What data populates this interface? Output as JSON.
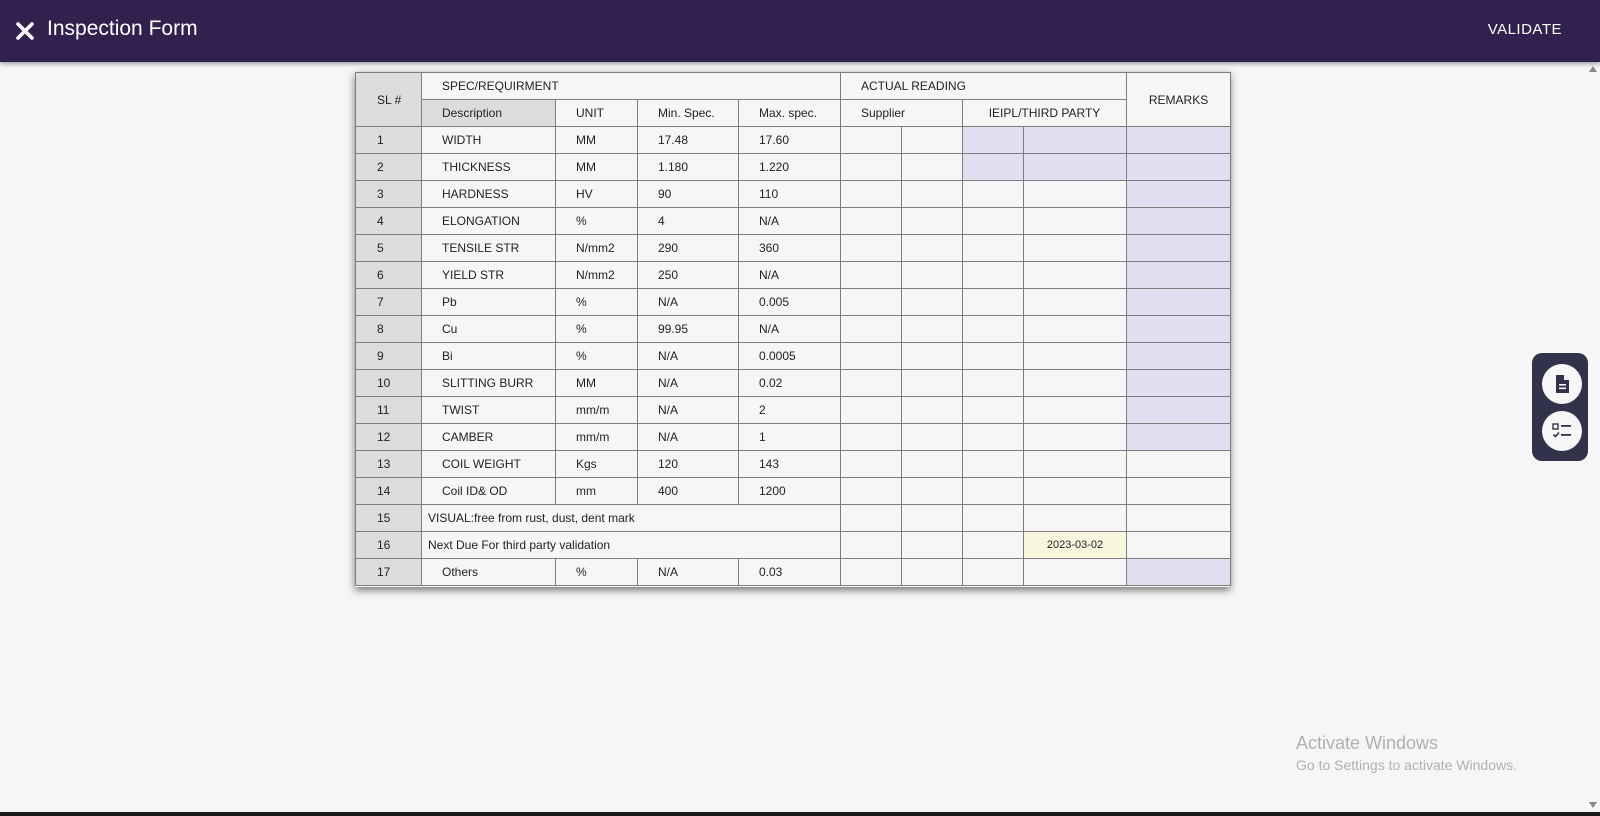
{
  "header": {
    "title": "Inspection Form",
    "validate_label": "VALIDATE"
  },
  "table": {
    "headers": {
      "sl": "SL #",
      "spec": "SPEC/REQUIRMENT",
      "actual": "ACTUAL READING",
      "remarks": "REMARKS",
      "description": "Description",
      "unit": "UNIT",
      "min": "Min. Spec.",
      "max": "Max. spec.",
      "supplier": "Supplier",
      "ieipl": "IEIPL/THIRD PARTY"
    },
    "rows": [
      {
        "sl": "1",
        "desc": "WIDTH",
        "unit": "MM",
        "min": "17.48",
        "max": "17.60"
      },
      {
        "sl": "2",
        "desc": "THICKNESS",
        "unit": "MM",
        "min": "1.180",
        "max": "1.220"
      },
      {
        "sl": "3",
        "desc": "HARDNESS",
        "unit": "HV",
        "min": "90",
        "max": "110"
      },
      {
        "sl": "4",
        "desc": "ELONGATION",
        "unit": "%",
        "min": "4",
        "max": "N/A"
      },
      {
        "sl": "5",
        "desc": "TENSILE STR",
        "unit": "N/mm2",
        "min": "290",
        "max": "360"
      },
      {
        "sl": "6",
        "desc": "YIELD STR",
        "unit": "N/mm2",
        "min": "250",
        "max": "N/A"
      },
      {
        "sl": "7",
        "desc": "Pb",
        "unit": "%",
        "min": "N/A",
        "max": "0.005"
      },
      {
        "sl": "8",
        "desc": "Cu",
        "unit": "%",
        "min": "99.95",
        "max": "N/A"
      },
      {
        "sl": "9",
        "desc": "Bi",
        "unit": "%",
        "min": "N/A",
        "max": "0.0005"
      },
      {
        "sl": "10",
        "desc": "SLITTING BURR",
        "unit": "MM",
        "min": "N/A",
        "max": "0.02"
      },
      {
        "sl": "11",
        "desc": "TWIST",
        "unit": "mm/m",
        "min": "N/A",
        "max": "2"
      },
      {
        "sl": "12",
        "desc": "CAMBER",
        "unit": "mm/m",
        "min": "N/A",
        "max": "1"
      },
      {
        "sl": "13",
        "desc": "COIL WEIGHT",
        "unit": "Kgs",
        "min": "120",
        "max": "143"
      },
      {
        "sl": "14",
        "desc": "Coil ID& OD",
        "unit": "mm",
        "min": "400",
        "max": "1200"
      }
    ],
    "visual_row": {
      "sl": "15",
      "text": "VISUAL:free from rust, dust, dent mark"
    },
    "due_row": {
      "sl": "16",
      "text": "Next Due For third party validation",
      "date": "2023-03-02"
    },
    "others_row": {
      "sl": "17",
      "desc": "Others",
      "unit": "%",
      "min": "N/A",
      "max": "0.03"
    }
  },
  "side_actions": {
    "document_icon": "document-icon",
    "checklist_icon": "checklist-icon"
  },
  "watermark": {
    "title": "Activate Windows",
    "subtitle": "Go to Settings to activate Windows."
  },
  "colors": {
    "header_bg": "#32214f",
    "editable_cell": "#e2ddf1",
    "date_cell": "#f8f6dc"
  }
}
